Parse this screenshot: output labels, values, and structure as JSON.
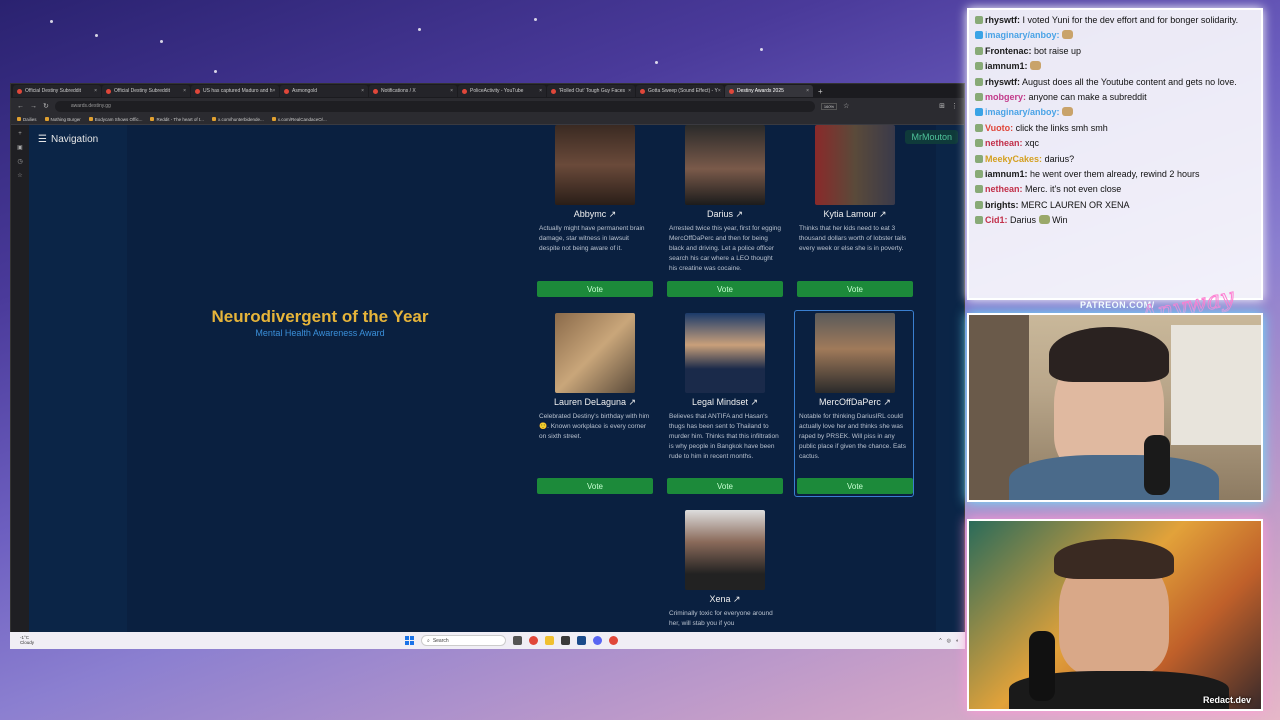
{
  "browser": {
    "tabs": [
      {
        "label": "Official Destiny Subreddit"
      },
      {
        "label": "Official Destiny Subreddit"
      },
      {
        "label": "US has captured Maduro and h"
      },
      {
        "label": "Asmongold"
      },
      {
        "label": "Notifications / X"
      },
      {
        "label": "PoliceActivity - YouTube"
      },
      {
        "label": "'Rolled Out' Tough Guy Faces"
      },
      {
        "label": "Gotta Sweep (Sound Effect) - Y"
      },
      {
        "label": "Destiny Awards 2025"
      }
    ],
    "url": "awards.destiny.gg",
    "zoom": "160%",
    "bookmarks": [
      "Dailies",
      "Nothing Burger",
      "Bodycam Shows Offic...",
      "Reddit - The heart of t...",
      "x.com/hunterbidende...",
      "x.com/RealCandaceO/..."
    ],
    "status_link": "streamable.com/cfskj3"
  },
  "page": {
    "nav_label": "Navigation",
    "user_tag": "MrMouton",
    "award_title": "Neurodivergent of the Year",
    "award_subtitle": "Mental Health Awareness Award",
    "vote_label": "Vote",
    "nominees": [
      {
        "name": "Abbymc ↗",
        "desc": "Actually might have permanent brain damage, star witness in lawsuit despite not being aware of it."
      },
      {
        "name": "Darius ↗",
        "desc": "Arrested twice this year, first for egging MercOffDaPerc and then for being black and driving. Let a police officer search his car where a LEO thought his creatine was cocaine."
      },
      {
        "name": "Kytia Lamour ↗",
        "desc": "Thinks that her kids need to eat 3 thousand dollars worth of lobster tails every week or else she is in poverty."
      },
      {
        "name": "Lauren DeLaguna ↗",
        "desc": "Celebrated Destiny's birthday with him 🙂. Known workplace is every corner on sixth street."
      },
      {
        "name": "Legal Mindset ↗",
        "desc": "Believes that ANTIFA and Hasan's thugs has been sent to Thailand to murder him. Thinks that this infiltration is why people in Bangkok have been rude to him in recent months."
      },
      {
        "name": "MercOffDaPerc ↗",
        "desc": "Notable for thinking DariusIRL could actually love her and thinks she was raped by PRSEK. Will piss in any public place if given the chance. Eats cactus."
      },
      {
        "name": "Xena ↗",
        "desc": "Criminally toxic for everyone around her, will stab you if you"
      }
    ]
  },
  "taskbar": {
    "weather_temp": "-1°C",
    "weather_desc": "Cloudy",
    "search_placeholder": "Search"
  },
  "chat": {
    "messages": [
      {
        "user": "rhyswtf:",
        "text": "I voted Yuni for the dev effort and for bonger solidarity.",
        "color": "#1a1a1a"
      },
      {
        "user": "imaginary/anboy:",
        "text": "",
        "color": "#4aa3e6"
      },
      {
        "user": "Frontenac:",
        "text": "bot raise up",
        "color": "#1a1a1a"
      },
      {
        "user": "iamnum1:",
        "text": "",
        "color": "#1a1a1a"
      },
      {
        "user": "rhyswtf:",
        "text": "August does all the Youtube content and gets no love.",
        "color": "#1a1a1a"
      },
      {
        "user": "mobgery:",
        "text": "anyone can make a subreddit",
        "color": "#c23a8a"
      },
      {
        "user": "imaginary/anboy:",
        "text": "",
        "color": "#4aa3e6"
      },
      {
        "user": "Vuoto:",
        "text": "click the links smh smh",
        "color": "#e0473a"
      },
      {
        "user": "nethean:",
        "text": "xqc",
        "color": "#c2304a"
      },
      {
        "user": "MeekyCakes:",
        "text": "darius?",
        "color": "#d4a020"
      },
      {
        "user": "iamnum1:",
        "text": "he went over them already, rewind 2 hours",
        "color": "#1a1a1a"
      },
      {
        "user": "nethean:",
        "text": "Merc. it's not even close",
        "color": "#c2304a"
      },
      {
        "user": "brights:",
        "text": "MERC LAUREN OR XENA",
        "color": "#1a1a1a"
      },
      {
        "user": "Cid1:",
        "text": "Darius",
        "text2": "Win",
        "color": "#c2304a"
      }
    ]
  },
  "overlay": {
    "patreon": "PATREON.COM/",
    "cam_credit": "Redact.dev"
  }
}
